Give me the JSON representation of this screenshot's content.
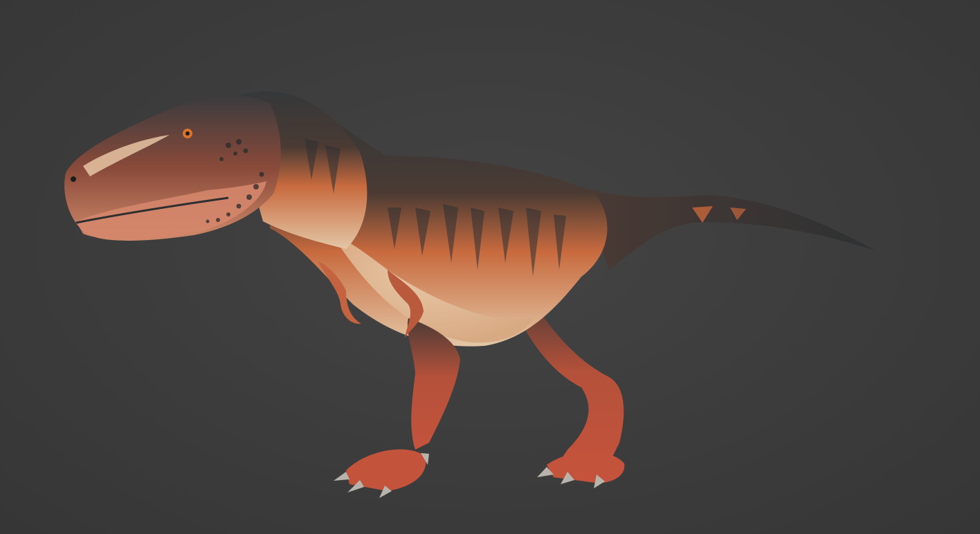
{
  "viewport": {
    "background_color": "#3b3b3b"
  },
  "subject": {
    "icon": "dinosaur-icon",
    "palette": {
      "dark_back": "#35383a",
      "orange_mid": "#c86a3e",
      "red_leg": "#c4533c",
      "cream_belly": "#e3c7a6",
      "claw": "#b8b4ac",
      "eye": "#d9732f"
    }
  }
}
